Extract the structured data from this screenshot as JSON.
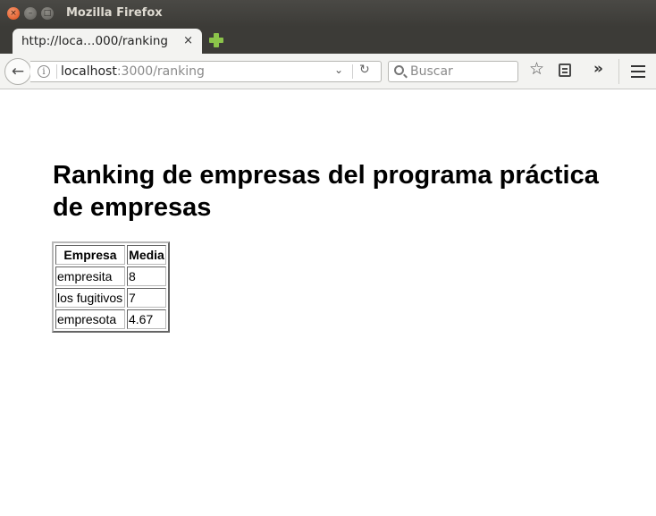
{
  "window": {
    "title": "Mozilla Firefox",
    "close_glyph": "×",
    "min_glyph": "–",
    "max_glyph": "□"
  },
  "tab": {
    "title": "http://loca…000/ranking",
    "close_glyph": "×"
  },
  "navbar": {
    "back_glyph": "←",
    "info_glyph": "i",
    "url_host": "localhost",
    "url_path": ":3000/ranking",
    "dropdown_glyph": "⌄",
    "reload_glyph": "↻",
    "search_placeholder": "Buscar",
    "star_glyph": "☆",
    "overflow_glyph": "»"
  },
  "icons": [
    "back-icon",
    "info-icon",
    "dropdown-icon",
    "reload-icon",
    "search-icon",
    "star-icon",
    "reader-list-icon",
    "overflow-icon",
    "menu-icon",
    "new-tab-icon"
  ],
  "colors": {
    "titlebar": "#3c3b37",
    "close_button": "#df4b16",
    "new_tab_plus": "#8bc34a"
  },
  "page": {
    "heading": "Ranking de empresas del programa práctica de empresas",
    "table": {
      "headers": [
        "Empresa",
        "Media"
      ],
      "rows": [
        [
          "empresita",
          "8"
        ],
        [
          "los fugitivos",
          "7"
        ],
        [
          "empresota",
          "4.67"
        ]
      ]
    }
  }
}
